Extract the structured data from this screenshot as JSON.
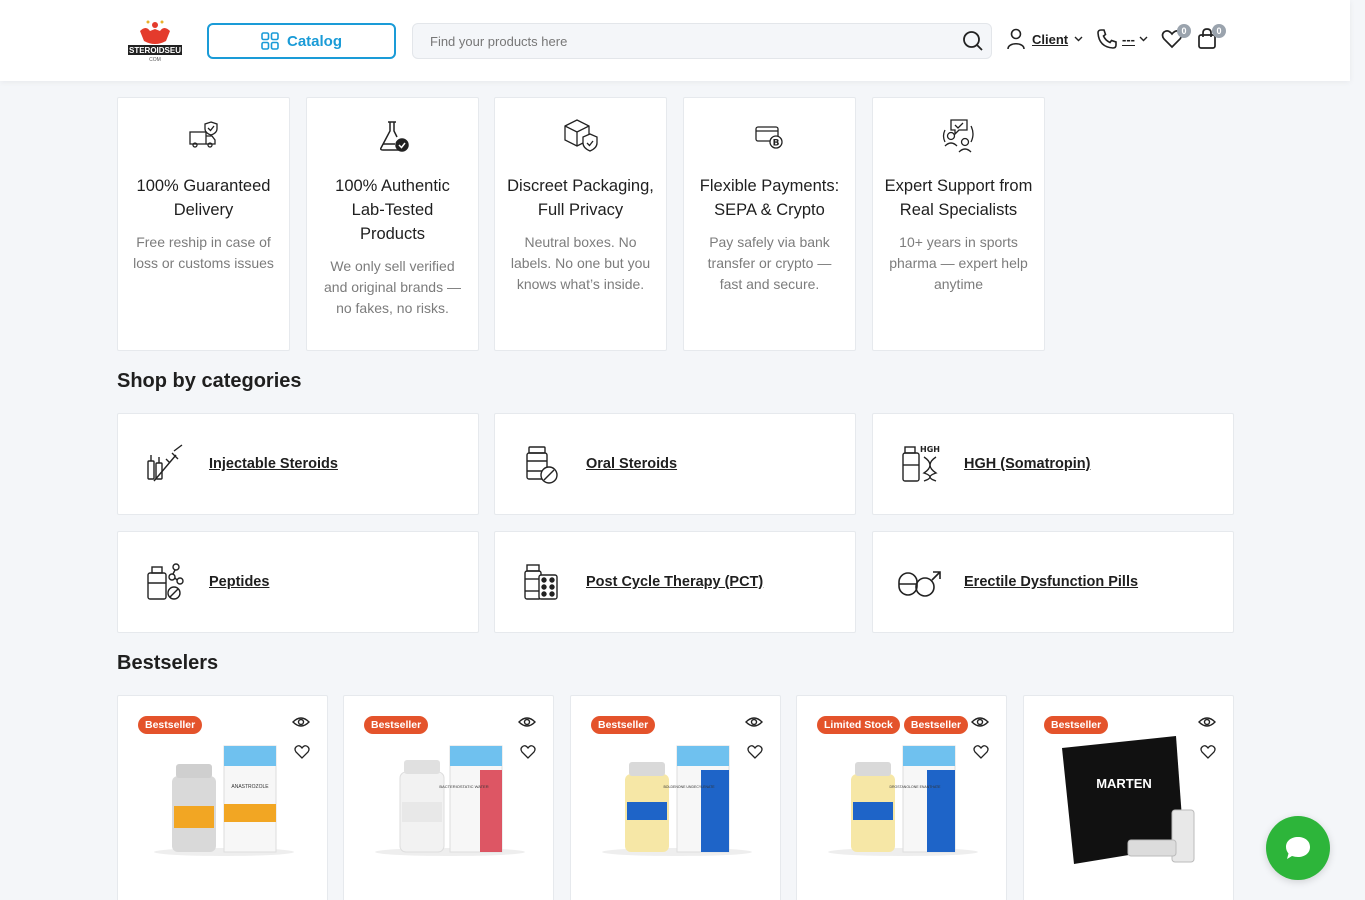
{
  "header": {
    "logo_text": "STEROIDSEU",
    "logo_subtext": "COM",
    "catalog_label": "Catalog",
    "search_placeholder": "Find your products here",
    "client_label": "Client",
    "phone_label": "---",
    "wishlist_count": "0",
    "cart_count": "0"
  },
  "features": [
    {
      "icon": "delivery-truck-shield-icon",
      "title": "100% Guaranteed Delivery",
      "desc": "Free reship in case of loss or customs issues"
    },
    {
      "icon": "lab-flask-check-icon",
      "title": "100% Authentic Lab-Tested Products",
      "desc": "We only sell verified and original brands — no fakes, no risks."
    },
    {
      "icon": "package-shield-icon",
      "title": "Discreet Packaging, Full Privacy",
      "desc": "Neutral boxes. No labels. No one but you knows what’s inside."
    },
    {
      "icon": "card-bitcoin-icon",
      "title": "Flexible Payments: SEPA & Crypto",
      "desc": "Pay safely via bank transfer or crypto — fast and secure."
    },
    {
      "icon": "support-specialist-icon",
      "title": "Expert Support from Real Specialists",
      "desc": "10+ years in sports pharma — expert help anytime"
    }
  ],
  "categories_title": "Shop by categories",
  "categories": [
    {
      "icon": "syringe-vial-icon",
      "label": "Injectable Steroids"
    },
    {
      "icon": "pill-bottle-icon",
      "label": "Oral Steroids"
    },
    {
      "icon": "hgh-dna-icon",
      "label": "HGH (Somatropin)"
    },
    {
      "icon": "peptide-bottle-icon",
      "label": "Peptides"
    },
    {
      "icon": "pct-blister-icon",
      "label": "Post Cycle Therapy (PCT)"
    },
    {
      "icon": "pill-male-symbol-icon",
      "label": "Erectile Dysfunction Pills"
    }
  ],
  "bestsellers_title": "Bestselers",
  "products": [
    {
      "tags": [
        "Bestseller"
      ],
      "label_text": "ANASTROZOLE",
      "accent": "#f2a623"
    },
    {
      "tags": [
        "Bestseller"
      ],
      "label_text": "BACTERIOSTATIC WATER",
      "accent": "#d83a4a"
    },
    {
      "tags": [
        "Bestseller"
      ],
      "label_text": "BOLDENONE UNDECYLENATE",
      "accent": "#1e64c8"
    },
    {
      "tags": [
        "Limited Stock",
        "Bestseller"
      ],
      "label_text": "DROSTANOLONE ENANTHATE",
      "accent": "#1e64c8"
    },
    {
      "tags": [
        "Bestseller"
      ],
      "label_text": "MARTEN",
      "accent": "#111111"
    }
  ],
  "colors": {
    "accent": "#1a9bd7",
    "tag": "#e4532b",
    "chat": "#2db53a"
  }
}
